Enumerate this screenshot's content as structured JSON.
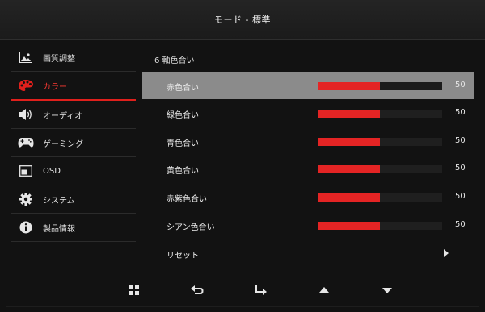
{
  "header": {
    "title": "モード - 標準"
  },
  "sidebar": {
    "items": [
      {
        "label": "画質調整",
        "icon": "picture-icon"
      },
      {
        "label": "カラー",
        "icon": "palette-icon",
        "active": true
      },
      {
        "label": "オーディオ",
        "icon": "speaker-icon"
      },
      {
        "label": "ゲーミング",
        "icon": "gamepad-icon"
      },
      {
        "label": "OSD",
        "icon": "osd-icon"
      },
      {
        "label": "システム",
        "icon": "gear-icon"
      },
      {
        "label": "製品情報",
        "icon": "info-icon"
      }
    ]
  },
  "main": {
    "section_title": "6 軸色合い",
    "rows": [
      {
        "label": "赤色合い",
        "value": "50",
        "level": 0.5
      },
      {
        "label": "緑色合い",
        "value": "50",
        "level": 0.5
      },
      {
        "label": "青色合い",
        "value": "50",
        "level": 0.5
      },
      {
        "label": "黄色合い",
        "value": "50",
        "level": 0.5
      },
      {
        "label": "赤紫色合い",
        "value": "50",
        "level": 0.5
      },
      {
        "label": "シアン色合い",
        "value": "50",
        "level": 0.5
      }
    ],
    "reset_label": "リセット"
  },
  "footer": {
    "buttons": [
      "menu-grid-icon",
      "back-icon",
      "enter-icon",
      "up-arrow-icon",
      "down-arrow-icon"
    ]
  },
  "colors": {
    "accent": "#e42424",
    "selected_row": "#8b8b8b",
    "background": "#121212"
  }
}
